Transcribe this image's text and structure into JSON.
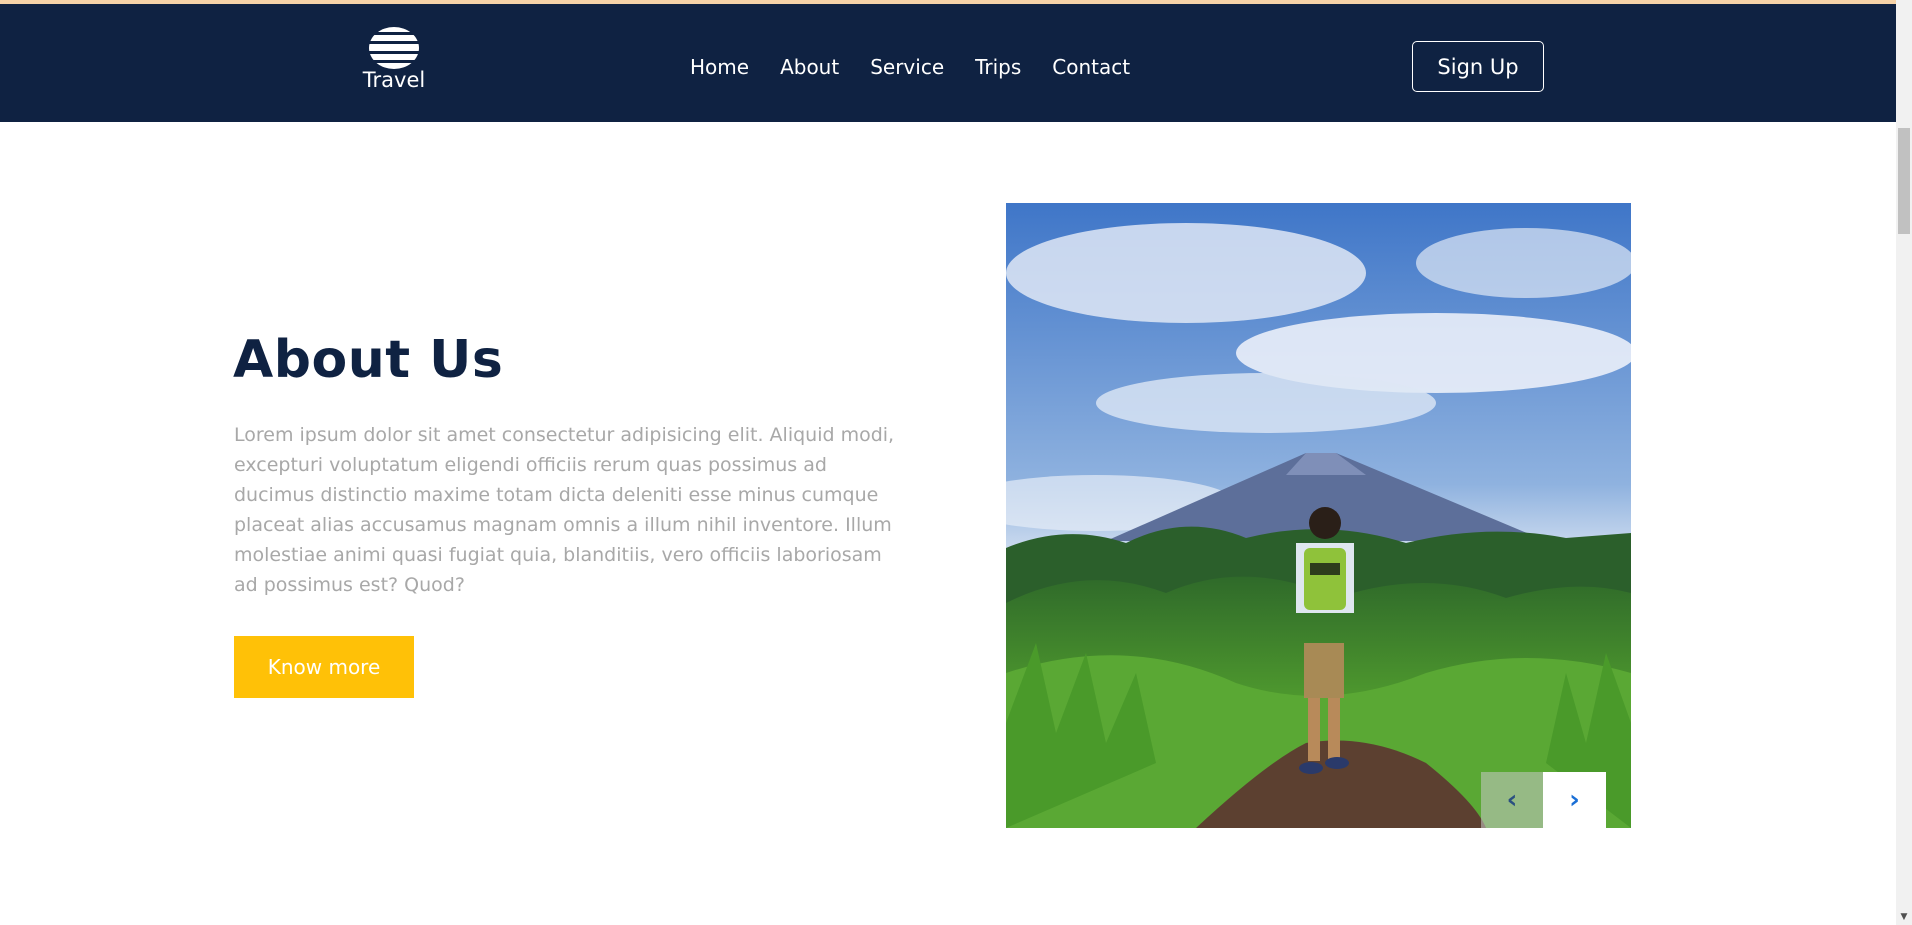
{
  "header": {
    "logo_text": "Travel",
    "nav": [
      "Home",
      "About",
      "Service",
      "Trips",
      "Contact"
    ],
    "signup_label": "Sign Up"
  },
  "about": {
    "title": "About Us",
    "body": "Lorem ipsum dolor sit amet consectetur adipisicing elit. Aliquid modi, excepturi voluptatum eligendi officiis rerum quas possimus ad ducimus distinctio maxime totam dicta deleniti esse minus cumque placeat alias accusamus magnam omnis a illum nihil inventore. Illum molestiae animi quasi fugiat quia, blanditiis, vero officiis laboriosam ad possimus est? Quod?",
    "button_label": "Know more"
  },
  "carousel": {
    "prev_icon": "chevron-left-icon",
    "next_icon": "chevron-right-icon"
  },
  "colors": {
    "navbar": "#0f2242",
    "accent_button": "#ffc107",
    "title": "#0f2242",
    "body_text": "#a8a8a8",
    "chevron": "#1a6fd6"
  }
}
